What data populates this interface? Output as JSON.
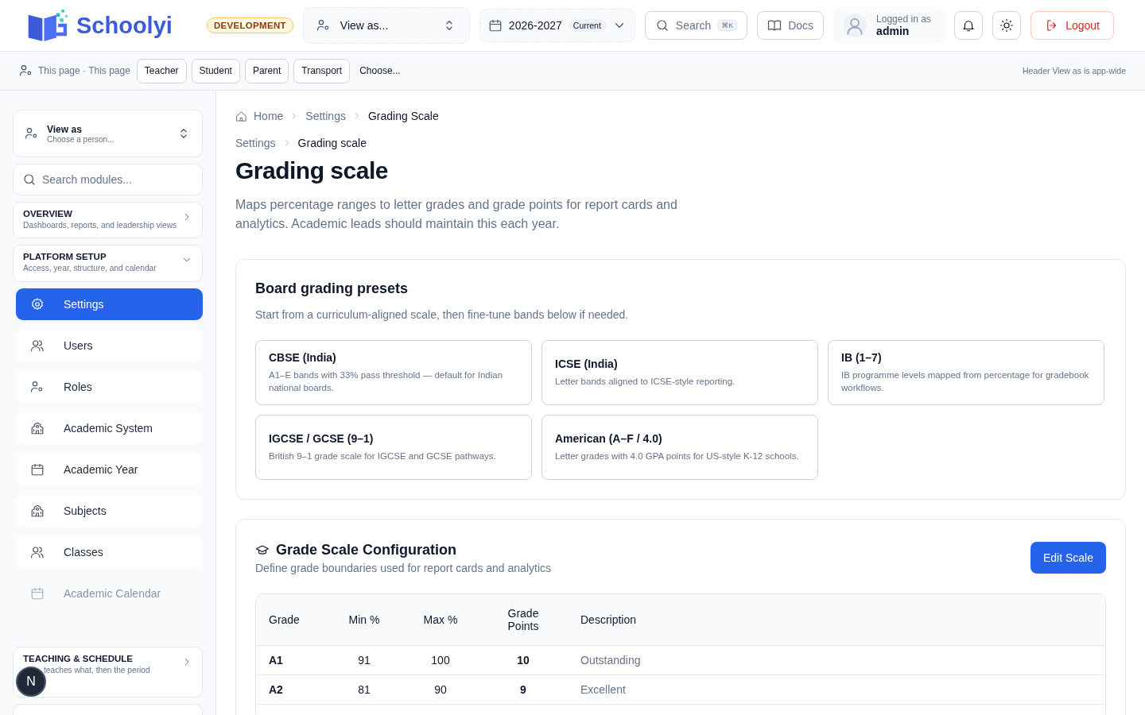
{
  "header": {
    "logo": "Schoolyi",
    "env_badge": "DEVELOPMENT",
    "view_as": "View as...",
    "year": {
      "label": "2026-2027",
      "badge": "Current"
    },
    "search": {
      "label": "Search",
      "shortcut": "⌘K"
    },
    "docs": "Docs",
    "user": {
      "caption": "Logged in as",
      "name": "admin"
    },
    "logout": "Logout"
  },
  "view_bar": {
    "label": "This page · This page",
    "chips": [
      "Teacher",
      "Student",
      "Parent",
      "Transport"
    ],
    "choose": "Choose...",
    "note": "Header View as is app-wide"
  },
  "sidebar": {
    "view_as": {
      "title": "View as",
      "subtitle": "Choose a person..."
    },
    "search": {
      "placeholder": "Search modules..."
    },
    "groups": [
      {
        "title": "OVERVIEW",
        "subtitle": "Dashboards, reports, and leadership views",
        "expanded": false
      },
      {
        "title": "PLATFORM SETUP",
        "subtitle": "Access, year, structure, and calendar",
        "expanded": true,
        "items": [
          {
            "label": "Settings",
            "selected": true,
            "disabled": false
          },
          {
            "label": "Users",
            "selected": false,
            "disabled": false
          },
          {
            "label": "Roles",
            "selected": false,
            "disabled": false
          },
          {
            "label": "Academic System",
            "selected": false,
            "disabled": false
          },
          {
            "label": "Academic Year",
            "selected": false,
            "disabled": false
          },
          {
            "label": "Subjects",
            "selected": false,
            "disabled": false
          },
          {
            "label": "Classes",
            "selected": false,
            "disabled": false
          },
          {
            "label": "Academic Calendar",
            "selected": false,
            "disabled": true
          }
        ]
      }
    ],
    "bottom_group": {
      "title": "TEACHING & SCHEDULE",
      "subtitle": "teaches what, then the period",
      "expanded": false
    },
    "floating_badge": "N"
  },
  "breadcrumb": [
    "Home",
    "Settings",
    "Grading Scale"
  ],
  "sub_breadcrumb": [
    "Settings",
    "Grading scale"
  ],
  "page": {
    "title": "Grading scale",
    "description": "Maps percentage ranges to letter grades and grade points for report cards and analytics. Academic leads should maintain this each year."
  },
  "presets": {
    "title": "Board grading presets",
    "subtitle": "Start from a curriculum-aligned scale, then fine-tune bands below if needed.",
    "cards": [
      {
        "title": "CBSE (India)",
        "text": "A1–E bands with 33% pass threshold — default for Indian national boards."
      },
      {
        "title": "ICSE (India)",
        "text": "Letter bands aligned to ICSE-style reporting."
      },
      {
        "title": "IB (1–7)",
        "text": "IB programme levels mapped from percentage for gradebook workflows."
      },
      {
        "title": "IGCSE / GCSE (9–1)",
        "text": "British 9–1 grade scale for IGCSE and GCSE pathways."
      },
      {
        "title": "American (A–F / 4.0)",
        "text": "Letter grades with 4.0 GPA points for US-style K-12 schools."
      }
    ]
  },
  "config": {
    "title": "Grade Scale Configuration",
    "subtitle": "Define grade boundaries used for report cards and analytics",
    "button": "Edit Scale",
    "table": {
      "columns": [
        "Grade",
        "Min %",
        "Max %",
        "Grade Points",
        "Description"
      ],
      "rows": [
        [
          "A1",
          "91",
          "100",
          "10",
          "Outstanding"
        ],
        [
          "A2",
          "81",
          "90",
          "9",
          "Excellent"
        ]
      ]
    }
  }
}
